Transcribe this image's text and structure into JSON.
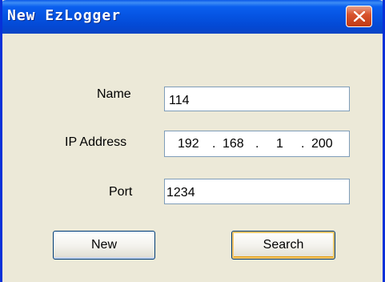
{
  "window": {
    "title": "New EzLogger",
    "close_icon": "close-x-icon"
  },
  "form": {
    "name_label": "Name",
    "name_value": "114",
    "ip_label": "IP Address",
    "ip_octets": [
      "192",
      "168",
      "1",
      "200"
    ],
    "ip_separator": ".",
    "port_label": "Port",
    "port_value": "1234"
  },
  "buttons": {
    "new_label": "New",
    "search_label": "Search"
  },
  "colors": {
    "titlebar": "#0553e1",
    "window_bg": "#ece9d8",
    "close_button": "#d8542e",
    "field_border": "#7f9db9"
  }
}
